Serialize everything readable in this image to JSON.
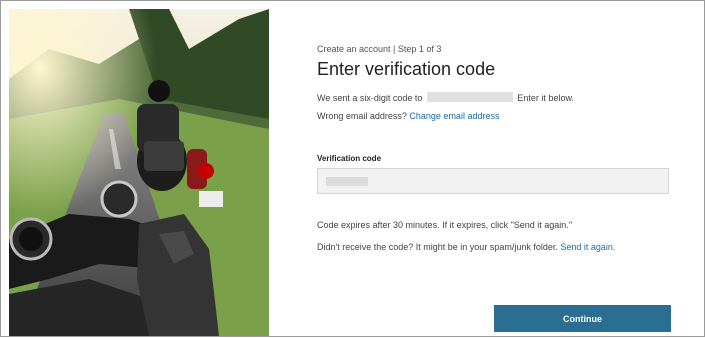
{
  "page": {
    "step_text": "Create an account | Step 1 of 3",
    "title": "Enter verification code",
    "sent_prefix": "We sent a six-digit code to",
    "sent_suffix": "Enter it below.",
    "wrong_email_text": "Wrong email address?",
    "change_email_link": "Change email address",
    "verification_label": "Verification code",
    "expires_text": "Code expires after 30 minutes. If it expires, click \"Send it again.\"",
    "didnt_receive_text": "Didn't receive the code? It might be in your spam/junk folder.",
    "send_again_link": "Send it again.",
    "continue_label": "Continue"
  },
  "colors": {
    "link": "#1e6aa5",
    "button": "#2a6e94",
    "input_bg": "#f2f2f2"
  }
}
